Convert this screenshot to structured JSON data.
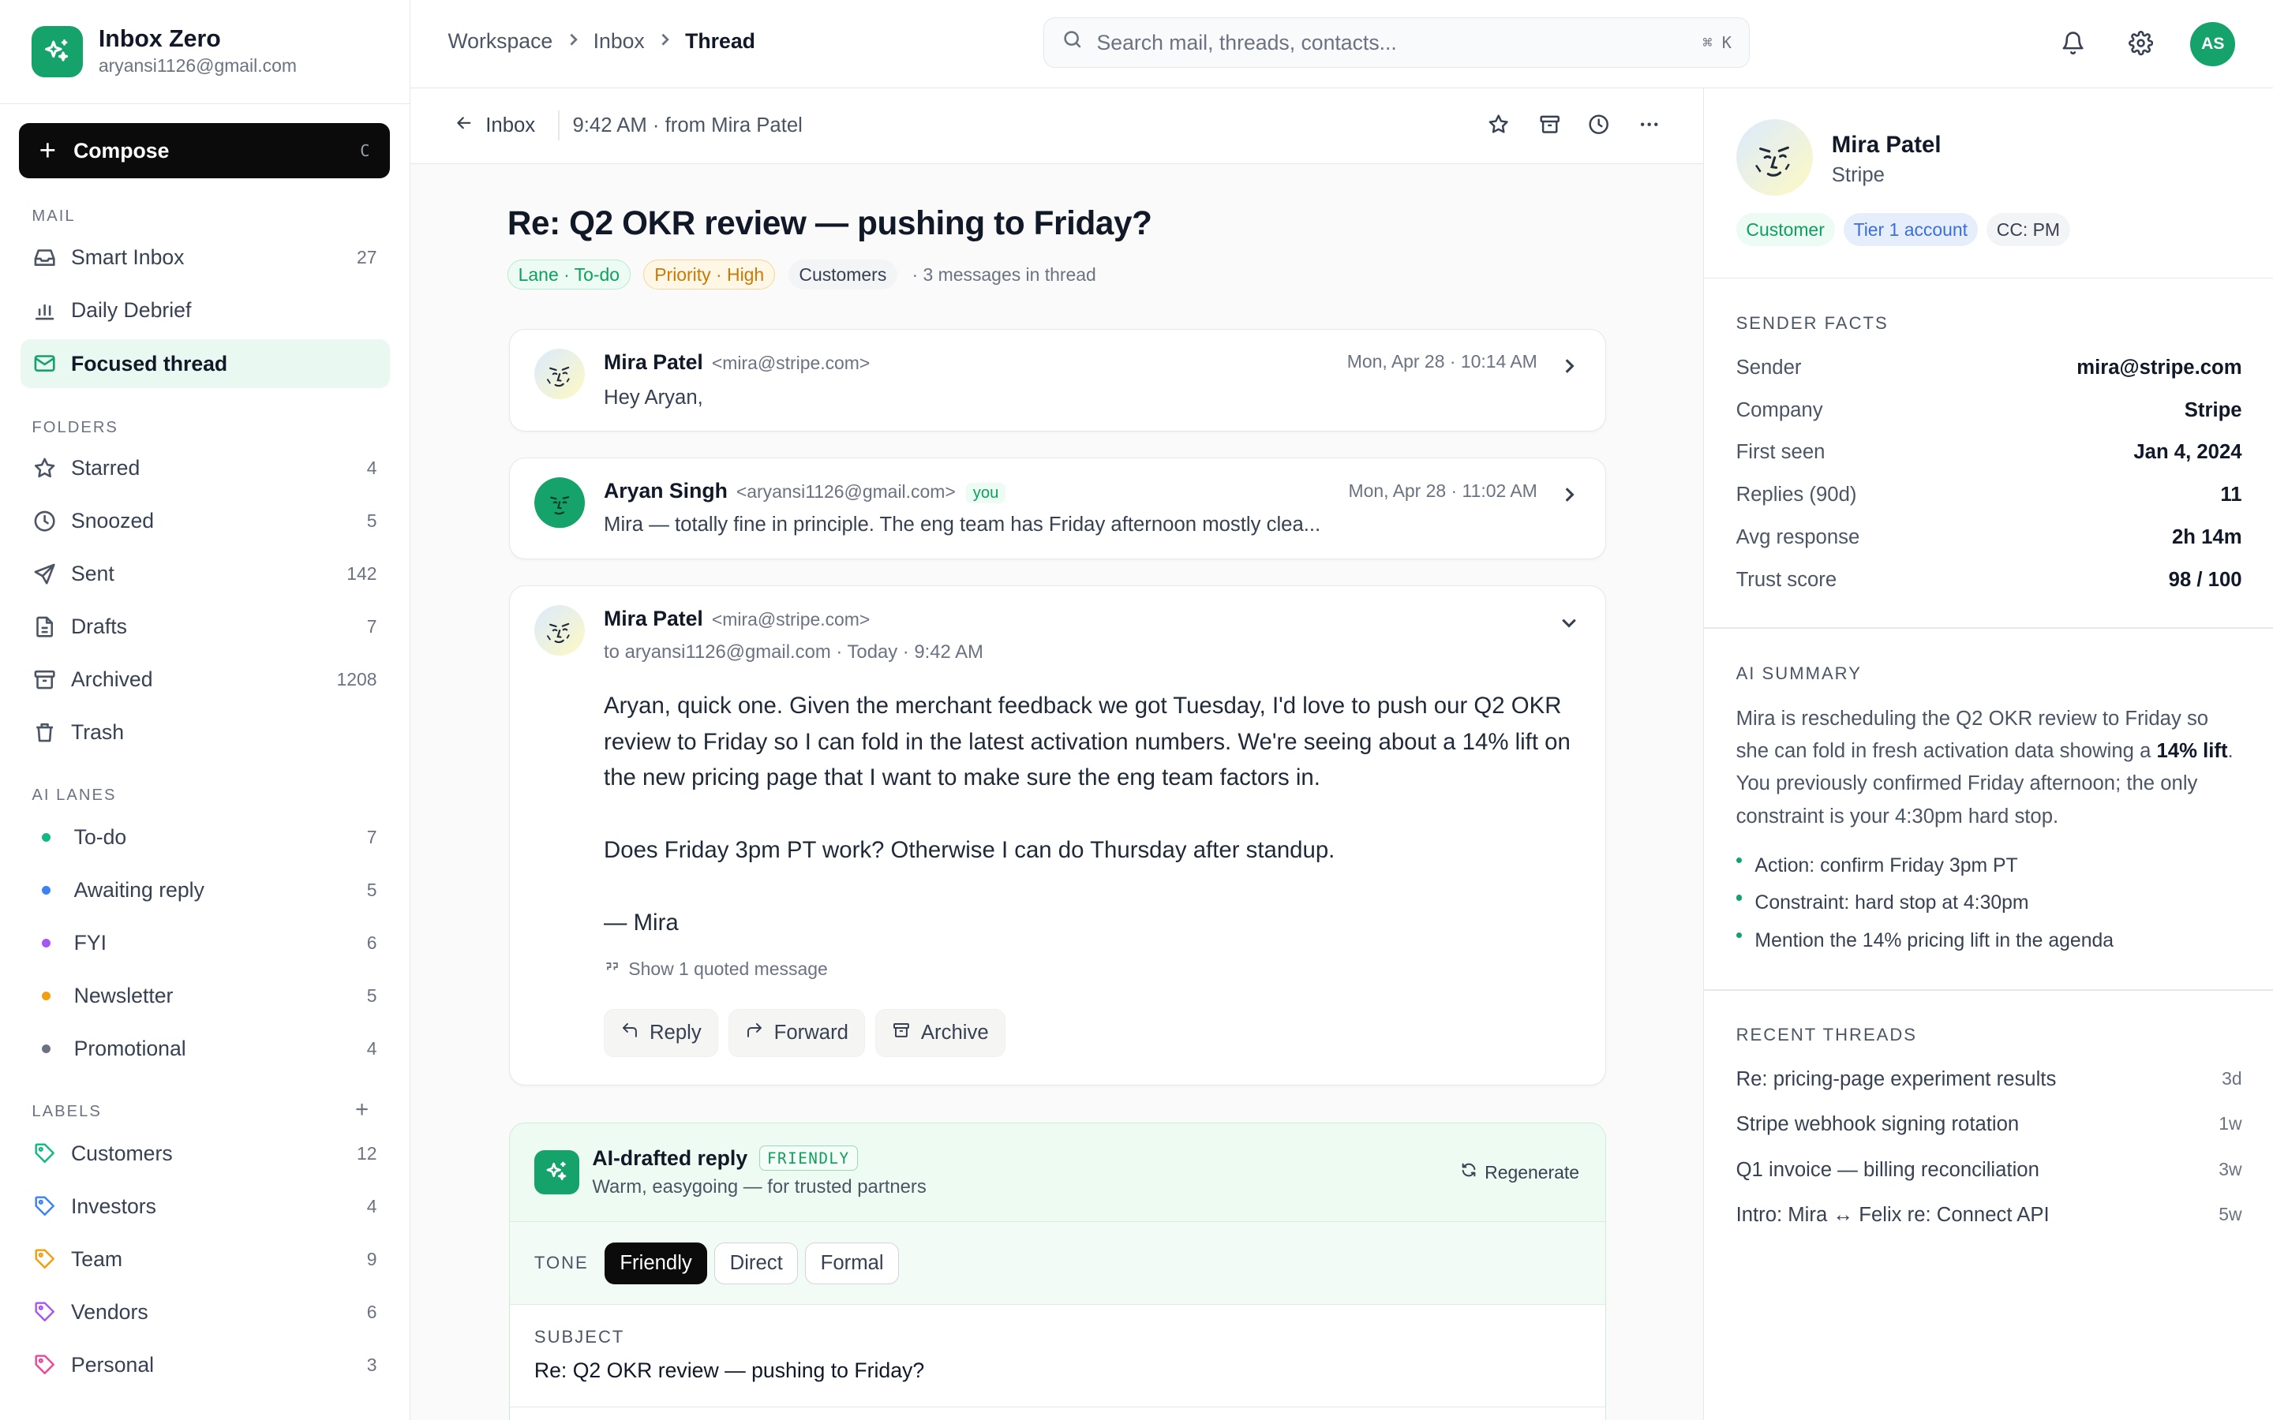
{
  "app": {
    "name": "Inbox Zero",
    "account_email": "aryansi1126@gmail.com"
  },
  "compose": {
    "label": "Compose",
    "shortcut": "C"
  },
  "sidebar": {
    "mail_title": "MAIL",
    "mail": [
      {
        "label": "Smart Inbox",
        "count": "27",
        "icon": "inbox-icon"
      },
      {
        "label": "Daily Debrief",
        "count": "",
        "icon": "bar-chart-icon"
      },
      {
        "label": "Focused thread",
        "count": "",
        "icon": "mail-icon",
        "active": true
      }
    ],
    "folders_title": "FOLDERS",
    "folders": [
      {
        "label": "Starred",
        "count": "4",
        "icon": "star-icon"
      },
      {
        "label": "Snoozed",
        "count": "5",
        "icon": "clock-icon"
      },
      {
        "label": "Sent",
        "count": "142",
        "icon": "send-icon"
      },
      {
        "label": "Drafts",
        "count": "7",
        "icon": "file-icon"
      },
      {
        "label": "Archived",
        "count": "1208",
        "icon": "archive-icon"
      },
      {
        "label": "Trash",
        "count": "",
        "icon": "trash-icon"
      }
    ],
    "lanes_title": "AI LANES",
    "lanes": [
      {
        "label": "To-do",
        "count": "7",
        "color": "#10b981"
      },
      {
        "label": "Awaiting reply",
        "count": "5",
        "color": "#3b82f6"
      },
      {
        "label": "FYI",
        "count": "6",
        "color": "#a855f7"
      },
      {
        "label": "Newsletter",
        "count": "5",
        "color": "#f59e0b"
      },
      {
        "label": "Promotional",
        "count": "4",
        "color": "#6b7280"
      }
    ],
    "labels_title": "LABELS",
    "labels_add": "+",
    "labels": [
      {
        "label": "Customers",
        "count": "12",
        "color": "#10b981"
      },
      {
        "label": "Investors",
        "count": "4",
        "color": "#3b82f6"
      },
      {
        "label": "Team",
        "count": "9",
        "color": "#f59e0b"
      },
      {
        "label": "Vendors",
        "count": "6",
        "color": "#a855f7"
      },
      {
        "label": "Personal",
        "count": "3",
        "color": "#ec4899"
      }
    ]
  },
  "topbar": {
    "breadcrumbs": [
      "Workspace",
      "Inbox",
      "Thread"
    ],
    "search_placeholder": "Search mail, threads, contacts...",
    "search_shortcut": "⌘ K",
    "avatar_initials": "AS"
  },
  "thread_bar": {
    "back_label": "Inbox",
    "meta": "9:42 AM · from Mira Patel"
  },
  "thread": {
    "subject": "Re: Q2 OKR review — pushing to Friday?",
    "chips": [
      {
        "label": "Lane · To-do",
        "style": "green"
      },
      {
        "label": "Priority · High",
        "style": "amber"
      },
      {
        "label": "Customers",
        "style": "gray"
      }
    ],
    "message_count": "· 3 messages in thread",
    "messages": [
      {
        "name": "Mira Patel",
        "email": "<mira@stripe.com>",
        "date": "Mon, Apr 28 · 10:14 AM",
        "snippet": "Hey Aryan,"
      },
      {
        "name": "Aryan Singh",
        "email": "<aryansi1126@gmail.com>",
        "badge": "you",
        "date": "Mon, Apr 28 · 11:02 AM",
        "snippet": "Mira — totally fine in principle. The eng team has Friday afternoon mostly clea..."
      },
      {
        "name": "Mira Patel",
        "email": "<mira@stripe.com>",
        "to": "to aryansi1126@gmail.com · Today · 9:42 AM",
        "body": [
          "Aryan, quick one. Given the merchant feedback we got Tuesday, I'd love to push our Q2 OKR review to Friday so I can fold in the latest activation numbers. We're seeing about a 14% lift on the new pricing page that I want to make sure the eng team factors in.",
          "Does Friday 3pm PT work? Otherwise I can do Thursday after standup.",
          "— Mira"
        ],
        "quoted": "Show 1 quoted message",
        "actions": [
          "Reply",
          "Forward",
          "Archive"
        ]
      }
    ]
  },
  "ai_reply": {
    "title": "AI-drafted reply",
    "tag": "FRIENDLY",
    "subtitle": "Warm, easygoing — for trusted partners",
    "regenerate": "Regenerate",
    "tone_label": "TONE",
    "tones": [
      "Friendly",
      "Direct",
      "Formal"
    ],
    "active_tone": "Friendly",
    "subject_label": "SUBJECT",
    "subject": "Re: Q2 OKR review — pushing to Friday?"
  },
  "contact": {
    "name": "Mira Patel",
    "company": "Stripe",
    "chips": [
      {
        "label": "Customer",
        "style": "green"
      },
      {
        "label": "Tier 1 account",
        "style": "blue"
      },
      {
        "label": "CC: PM",
        "style": "gray"
      }
    ]
  },
  "sender_facts": {
    "title": "SENDER FACTS",
    "rows": [
      {
        "k": "Sender",
        "v": "mira@stripe.com"
      },
      {
        "k": "Company",
        "v": "Stripe"
      },
      {
        "k": "First seen",
        "v": "Jan 4, 2024"
      },
      {
        "k": "Replies (90d)",
        "v": "11"
      },
      {
        "k": "Avg response",
        "v": "2h 14m"
      },
      {
        "k": "Trust score",
        "v": "98 / 100"
      }
    ]
  },
  "ai_summary": {
    "title": "AI SUMMARY",
    "text_before": "Mira is rescheduling the Q2 OKR review to Friday so she can fold in fresh activation data showing a ",
    "text_bold": "14% lift",
    "text_after": ". You previously confirmed Friday afternoon; the only constraint is your 4:30pm hard stop.",
    "bullets": [
      "Action: confirm Friday 3pm PT",
      "Constraint: hard stop at 4:30pm",
      "Mention the 14% pricing lift in the agenda"
    ]
  },
  "recent_threads": {
    "title": "RECENT THREADS",
    "items": [
      {
        "title": "Re: pricing-page experiment results",
        "age": "3d"
      },
      {
        "title": "Stripe webhook signing rotation",
        "age": "1w"
      },
      {
        "title": "Q1 invoice — billing reconciliation",
        "age": "3w"
      },
      {
        "title": "Intro: Mira ↔ Felix re: Connect API",
        "age": "5w"
      }
    ]
  }
}
